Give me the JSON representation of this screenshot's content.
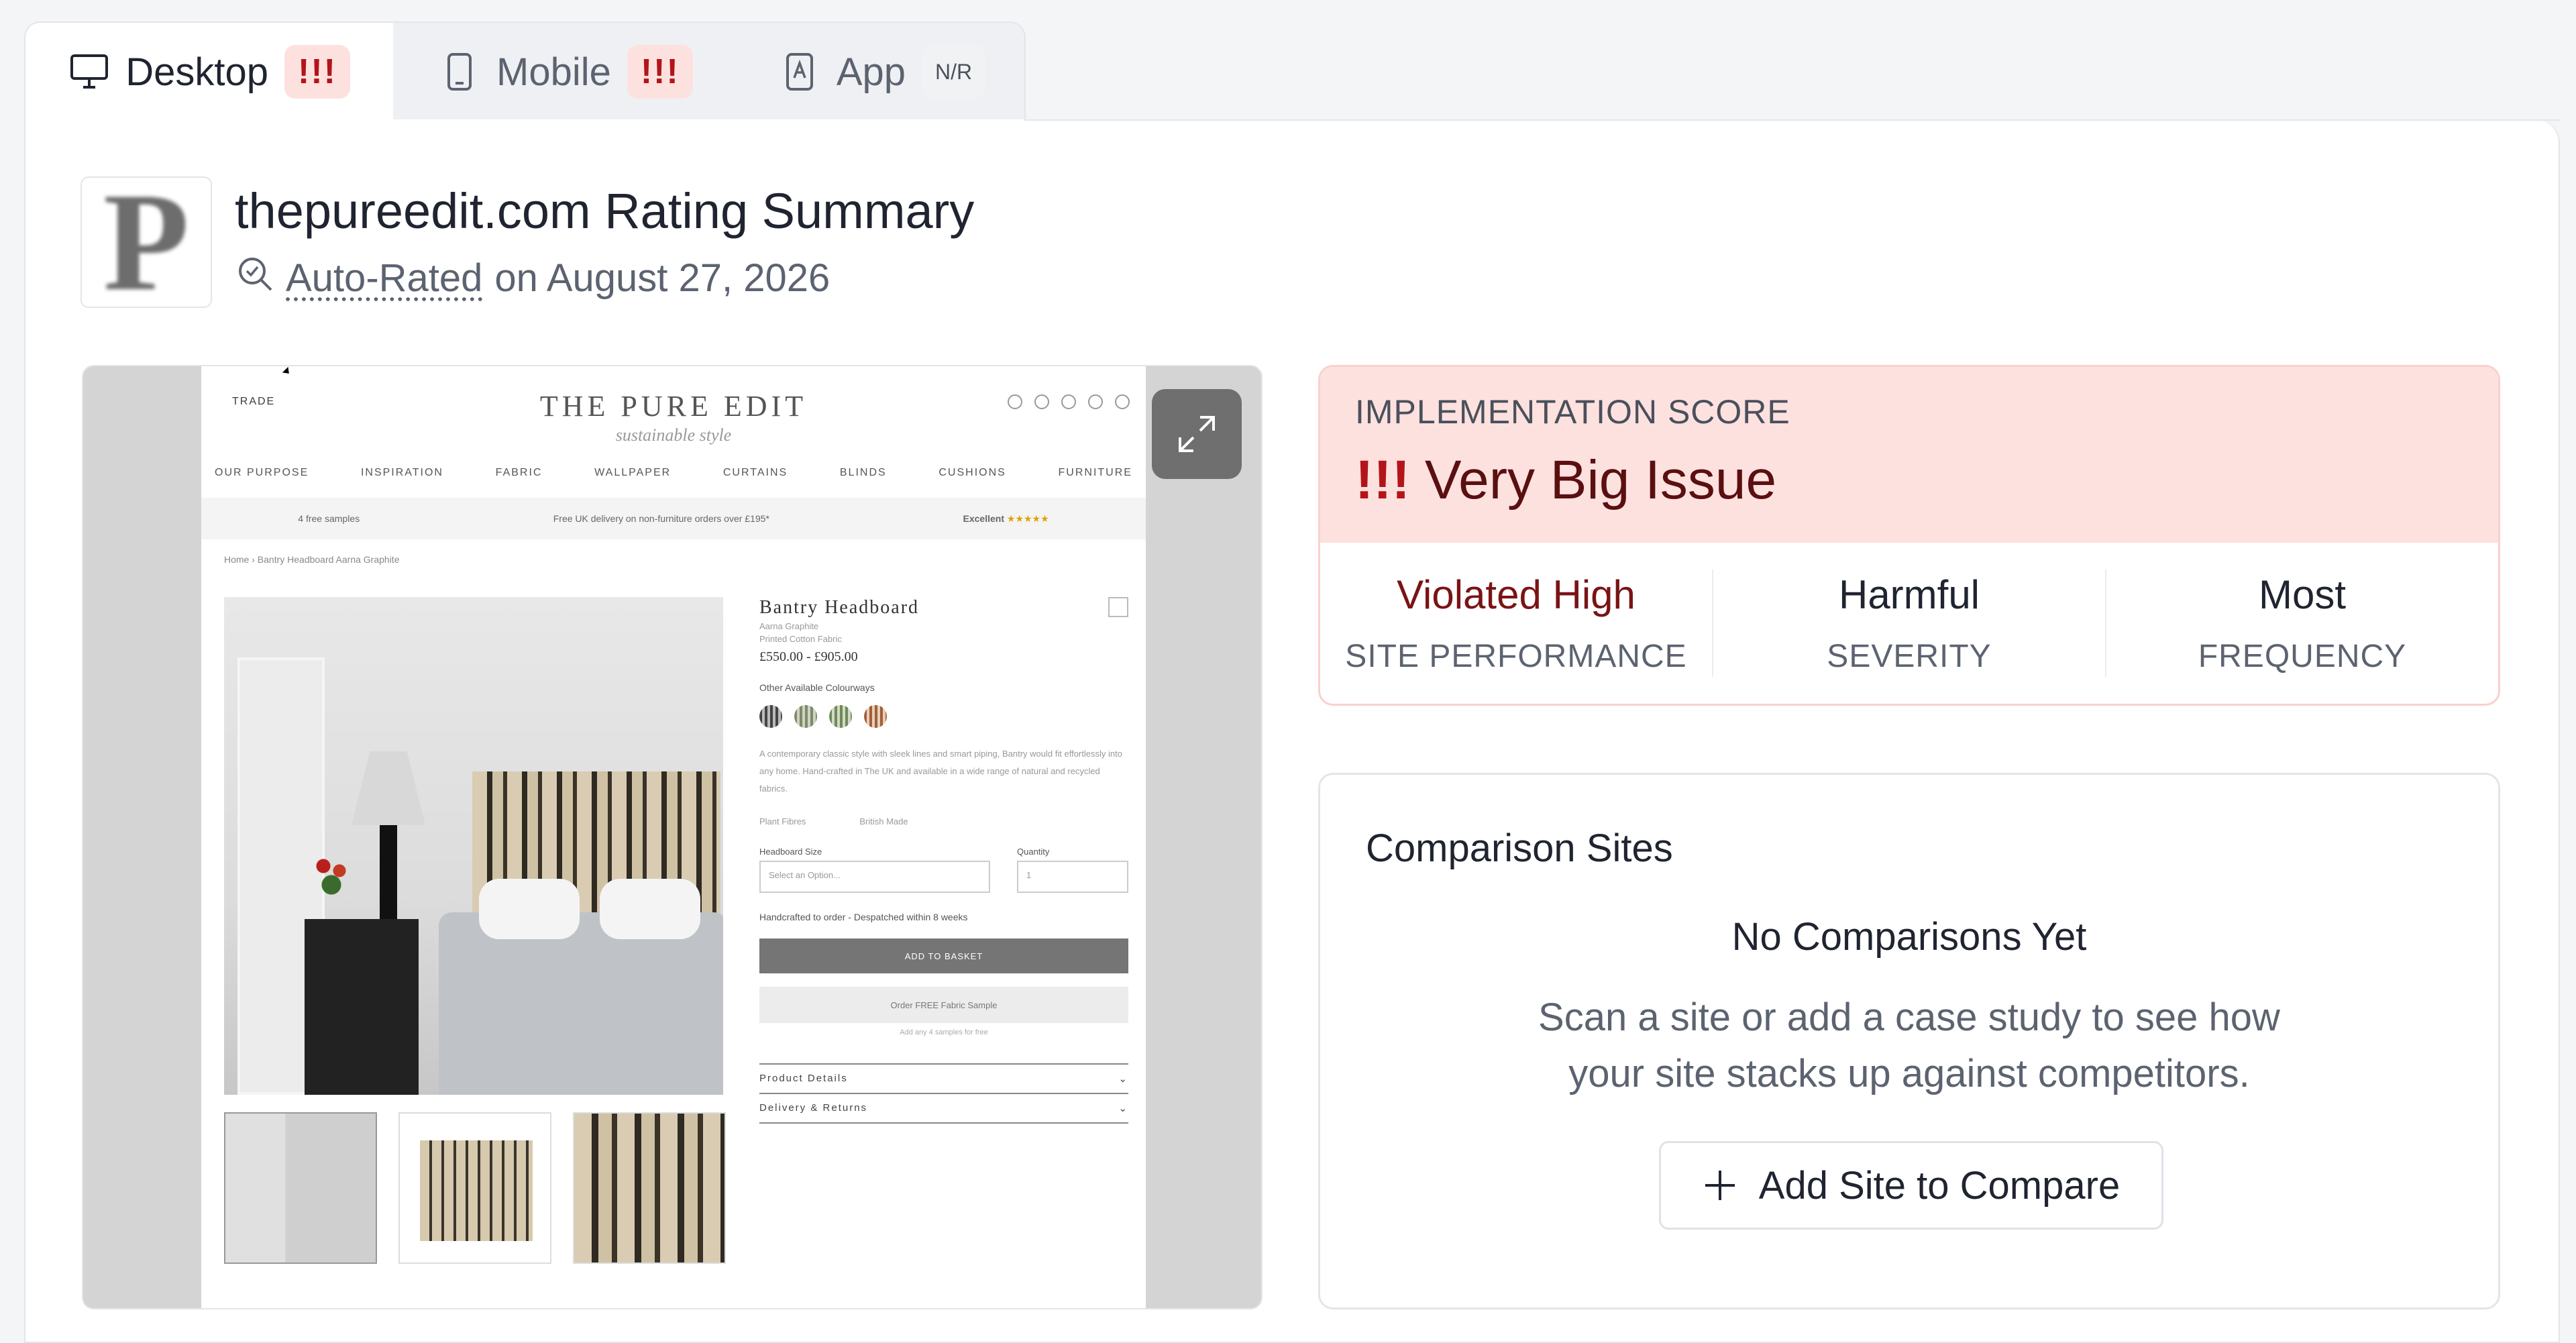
{
  "tabs": [
    {
      "label": "Desktop",
      "badge": "!!!",
      "icon": "desktop-icon"
    },
    {
      "label": "Mobile",
      "badge": "!!!",
      "icon": "mobile-icon"
    },
    {
      "label": "App",
      "badge": "N/R",
      "icon": "app-icon"
    }
  ],
  "header": {
    "logo_letter": "P",
    "title": "thepureedit.com Rating Summary",
    "rated_link": "Auto-Rated",
    "rated_suffix": "on August 27, 2026"
  },
  "preview_site": {
    "trade": "TRADE",
    "brand": "THE PURE EDIT",
    "tagline": "sustainable style",
    "nav": [
      "OUR PURPOSE",
      "INSPIRATION",
      "FABRIC",
      "WALLPAPER",
      "CURTAINS",
      "BLINDS",
      "CUSHIONS",
      "FURNITURE"
    ],
    "strip": [
      "4 free samples",
      "Free UK delivery on non-furniture orders over £195*",
      "Excellent"
    ],
    "stars": "★★★★★",
    "breadcrumb": "Home  ›  Bantry Headboard Aarna Graphite",
    "product_name": "Bantry Headboard",
    "product_sub1": "Aarna Graphite",
    "product_sub2": "Printed Cotton Fabric",
    "price": "£550.00 - £905.00",
    "colourways_label": "Other Available Colourways",
    "description": "A contemporary classic style with sleek lines and smart piping, Bantry would fit effortlessly into any home. Hand-crafted in The UK and available in a wide range of natural and recycled fabrics.",
    "feature1": "Plant Fibres",
    "feature2": "British Made",
    "size_label": "Headboard Size",
    "size_placeholder": "Select an Option...",
    "qty_label": "Quantity",
    "qty_value": "1",
    "ship_note": "Handcrafted to order - Despatched within 8 weeks",
    "basket_btn": "ADD TO BASKET",
    "sample_btn": "Order FREE Fabric Sample",
    "sample_note": "Add any 4 samples for free",
    "acc1": "Product Details",
    "acc2": "Delivery & Returns"
  },
  "score": {
    "label": "IMPLEMENTATION SCORE",
    "bang": "!!!",
    "value": "Very Big Issue",
    "metrics": [
      {
        "value": "Violated High",
        "key": "SITE PERFORMANCE"
      },
      {
        "value": "Harmful",
        "key": "SEVERITY"
      },
      {
        "value": "Most",
        "key": "FREQUENCY"
      }
    ],
    "colors": {
      "bg": "#fde1df",
      "accent": "#b3141a",
      "dark": "#5a0f10"
    }
  },
  "comparison": {
    "title": "Comparison Sites",
    "empty_title": "No Comparisons Yet",
    "empty_line1": "Scan a site or add a case study to see how",
    "empty_line2": "your site stacks up against competitors.",
    "add_button": "Add Site to Compare",
    "add_icon": "plus-icon"
  }
}
